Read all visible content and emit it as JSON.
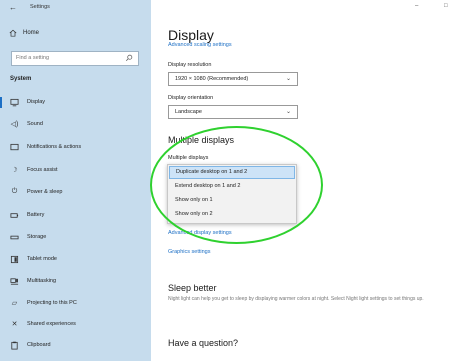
{
  "window": {
    "title": "Settings",
    "back_icon": "back-arrow-icon",
    "minimize_glyph": "–",
    "maximize_glyph": "□"
  },
  "sidebar": {
    "home_label": "Home",
    "search_placeholder": "Find a setting",
    "section_label": "System",
    "selected_index": 0,
    "items": [
      {
        "label": "Display",
        "icon": "monitor-icon"
      },
      {
        "label": "Sound",
        "icon": "speaker-icon"
      },
      {
        "label": "Notifications & actions",
        "icon": "notifications-icon"
      },
      {
        "label": "Focus assist",
        "icon": "moon-icon"
      },
      {
        "label": "Power & sleep",
        "icon": "power-icon"
      },
      {
        "label": "Battery",
        "icon": "battery-icon"
      },
      {
        "label": "Storage",
        "icon": "storage-icon"
      },
      {
        "label": "Tablet mode",
        "icon": "tablet-icon"
      },
      {
        "label": "Multitasking",
        "icon": "multitasking-icon"
      },
      {
        "label": "Projecting to this PC",
        "icon": "projecting-icon"
      },
      {
        "label": "Shared experiences",
        "icon": "shared-experiences-icon"
      },
      {
        "label": "Clipboard",
        "icon": "clipboard-icon"
      }
    ]
  },
  "main": {
    "title": "Display",
    "cut_off_link": "Advanced scaling settings",
    "resolution": {
      "label": "Display resolution",
      "value": "1920 × 1080 (Recommended)"
    },
    "orientation": {
      "label": "Display orientation",
      "value": "Landscape"
    },
    "multiple_displays": {
      "section_title": "Multiple displays",
      "label": "Multiple displays",
      "selected_index": 0,
      "options": [
        "Duplicate desktop on 1 and 2",
        "Extend desktop on 1 and 2",
        "Show only on 1",
        "Show only on 2"
      ]
    },
    "advanced_display_link": "Advanced display settings",
    "graphics_link": "Graphics settings",
    "sleep": {
      "title": "Sleep better",
      "text": "Night light can help you get to sleep by displaying warmer colors at night. Select Night light settings to set things up."
    },
    "question": {
      "title": "Have a question?"
    }
  },
  "colors": {
    "sidebar_bg": "#c6dced",
    "accent": "#1c6fc5",
    "annotation": "#2fd12f"
  }
}
